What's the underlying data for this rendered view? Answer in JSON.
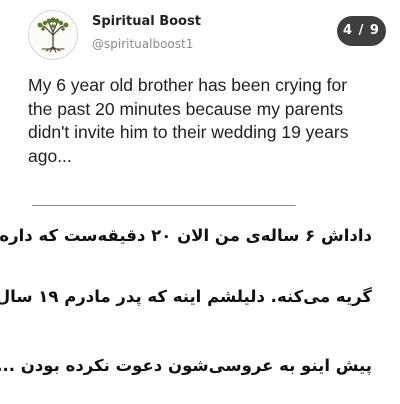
{
  "post": {
    "author": {
      "display_name": "Spiritual Boost",
      "handle": "@spiritualboost1",
      "avatar_icon": "tree-logo-icon"
    },
    "counter": "4 / 9",
    "text_lines": [
      "My 6 year old brother has been crying for",
      "the past 20 minutes because my parents",
      "didn't invite him to their wedding 19 years",
      "ago..."
    ],
    "divider": "________________________________",
    "translation_lines": [
      "داداش ۶ ساله‌ی من الان ۲۰ دقیقه‌ست که داره",
      "گریه می‌کنه. دلیلشم اینه که پدر مادرم ۱۹ سال",
      "پیش اینو به عروسی‌شون دعوت نکرده بودن ..."
    ]
  },
  "colors": {
    "counter_bg": "#3f3f3f",
    "tree_green": "#5a7a2e",
    "tree_trunk": "#4a3a26"
  }
}
